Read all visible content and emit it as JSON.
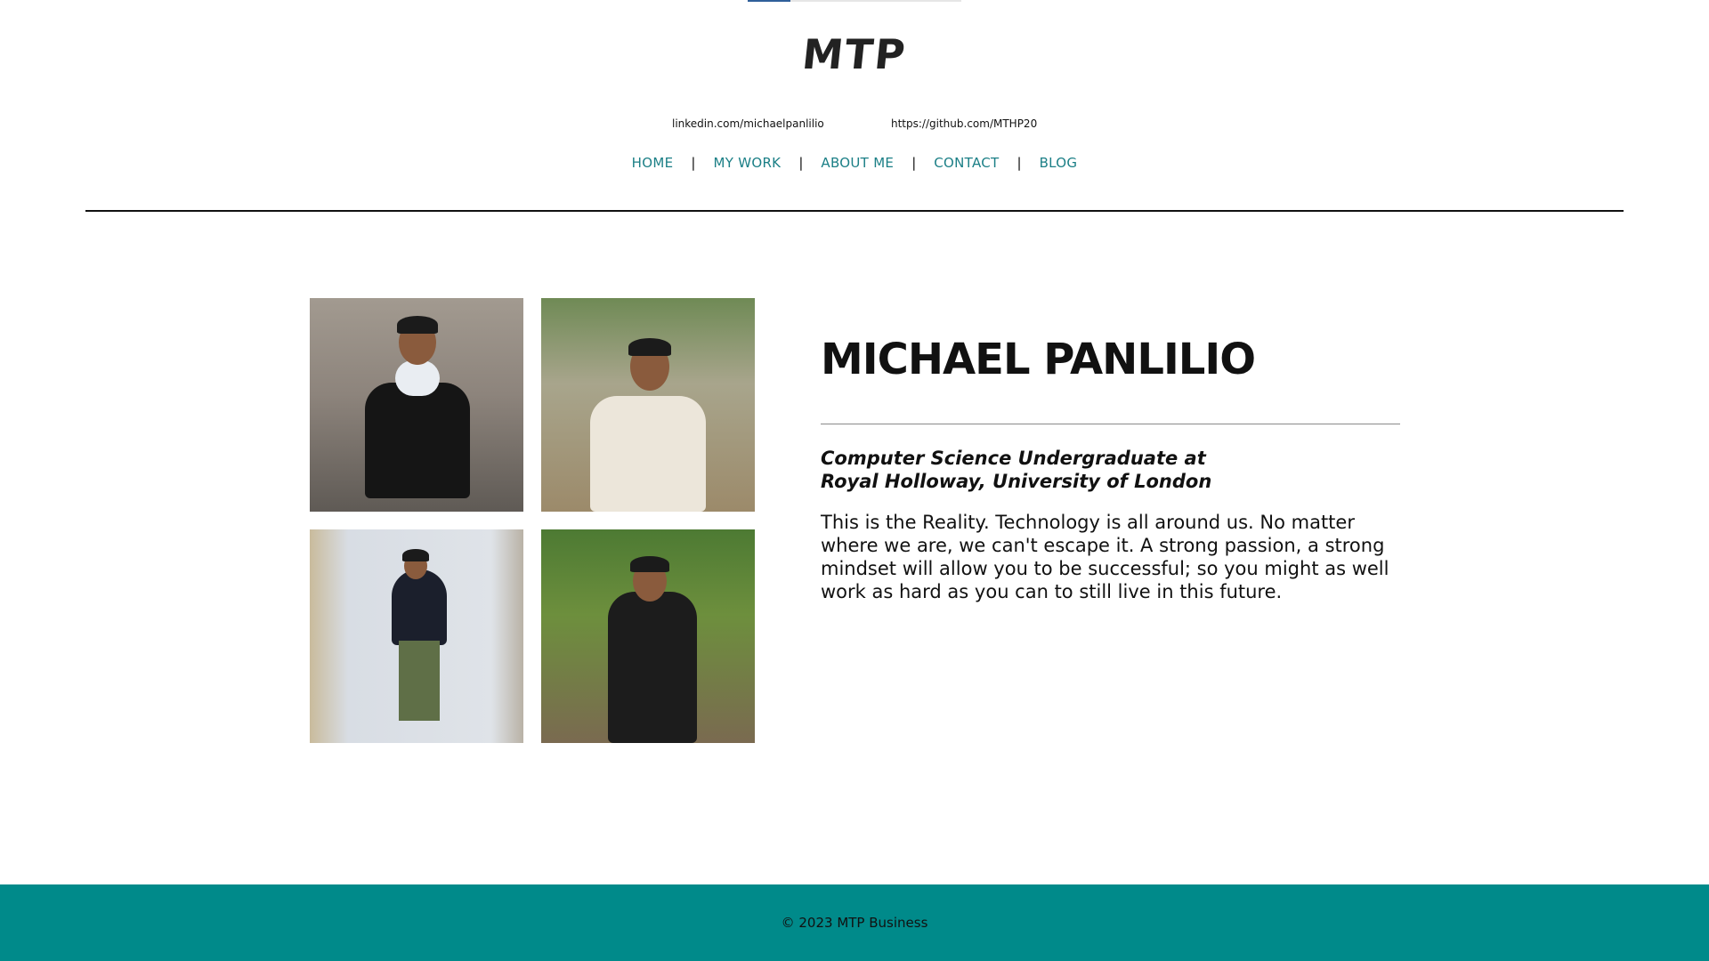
{
  "progress": {
    "fraction": 0.2
  },
  "header": {
    "logo": "MTP",
    "links": {
      "linkedin": "linkedin.com/michaelpanlilio",
      "github": "https://github.com/MTHP20"
    },
    "nav": [
      {
        "label": "HOME"
      },
      {
        "label": "MY WORK"
      },
      {
        "label": "ABOUT ME"
      },
      {
        "label": "CONTACT"
      },
      {
        "label": "BLOG"
      }
    ],
    "separator": "|"
  },
  "profile": {
    "name": "MICHAEL PANLILIO",
    "subtitle_line1": "Computer Science Undergraduate at",
    "subtitle_line2": "Royal Holloway, University of London",
    "bio": "This is the Reality. Technology is all around us. No matter where we are, we can't escape it. A strong passion, a strong mindset will allow you to be successful; so you might as well work as hard as you can to still live in this future."
  },
  "footer": {
    "text": "© 2023 MTP Business"
  },
  "colors": {
    "accent": "#008a8a",
    "nav_link": "#1b7f86",
    "text": "#111111"
  }
}
